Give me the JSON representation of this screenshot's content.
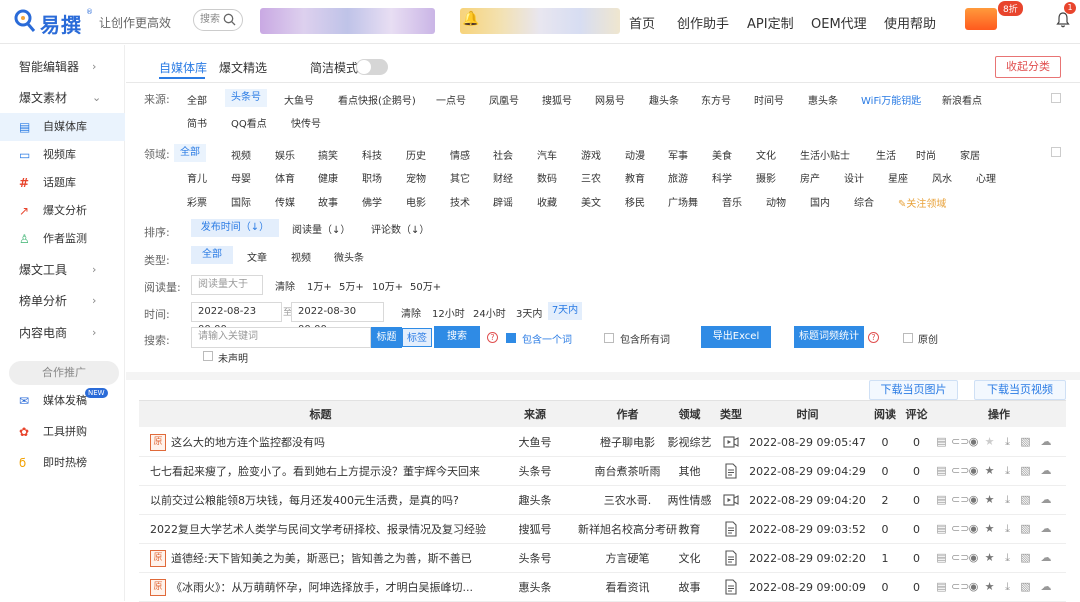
{
  "header": {
    "brand": "易撰",
    "slogan": "让创作更高效",
    "search_placeholder": "搜索",
    "nav": [
      "首页",
      "创作助手",
      "API定制",
      "OEM代理",
      "使用帮助"
    ],
    "promo_badge": "8折",
    "bell_count": "1"
  },
  "sidebar": {
    "items": [
      {
        "label": "智能编辑器",
        "chev": "›"
      },
      {
        "label": "爆文素材",
        "chev": "⌄"
      },
      {
        "label": "自媒体库"
      },
      {
        "label": "视频库"
      },
      {
        "label": "话题库"
      },
      {
        "label": "爆文分析"
      },
      {
        "label": "作者监测"
      },
      {
        "label": "爆文工具",
        "chev": "›"
      },
      {
        "label": "榜单分析",
        "chev": "›"
      },
      {
        "label": "内容电商",
        "chev": "›"
      }
    ],
    "promo_title": "合作推广",
    "promo_items": [
      "媒体发稿",
      "工具拼购",
      "即时热榜"
    ],
    "new_badge": "NEW"
  },
  "tabs": [
    "自媒体库",
    "爆文精选"
  ],
  "simple_mode_label": "简洁模式",
  "collapse_label": "收起分类",
  "filters": {
    "source_label": "来源:",
    "sources_row1": [
      "全部",
      "头条号",
      "大鱼号",
      "看点快报(企鹅号)",
      "一点号",
      "凤凰号",
      "搜狐号",
      "网易号",
      "趣头条",
      "东方号",
      "时间号",
      "惠头条",
      "WiFi万能钥匙",
      "新浪看点"
    ],
    "sources_row2": [
      "简书",
      "QQ看点",
      "快传号"
    ],
    "field_label": "领域:",
    "fields_row1": [
      "全部",
      "视频",
      "娱乐",
      "搞笑",
      "科技",
      "历史",
      "情感",
      "社会",
      "汽车",
      "游戏",
      "动漫",
      "军事",
      "美食",
      "文化",
      "生活小贴士",
      "生活",
      "时尚",
      "家居"
    ],
    "fields_row2": [
      "育儿",
      "母婴",
      "体育",
      "健康",
      "职场",
      "宠物",
      "其它",
      "财经",
      "数码",
      "三农",
      "教育",
      "旅游",
      "科学",
      "摄影",
      "房产",
      "设计",
      "星座",
      "风水",
      "心理"
    ],
    "fields_row3": [
      "彩票",
      "国际",
      "传媒",
      "故事",
      "佛学",
      "电影",
      "技术",
      "辟谣",
      "收藏",
      "美文",
      "移民",
      "广场舞",
      "音乐",
      "动物",
      "国内",
      "综合"
    ],
    "follow_field": "关注领域",
    "sort_label": "排序:",
    "sort_options": [
      "发布时间（↓）",
      "阅读量（↓）",
      "评论数（↓）"
    ],
    "type_label": "类型:",
    "type_options": [
      "全部",
      "文章",
      "视频",
      "微头条"
    ],
    "reads_label": "阅读量:",
    "reads_placeholder": "阅读量大于",
    "reads_options": [
      "清除",
      "1万+",
      "5万+",
      "10万+",
      "50万+"
    ],
    "time_label": "时间:",
    "time_start": "2022-08-23 00:00",
    "time_sep": "至",
    "time_end": "2022-08-30 00:00",
    "time_options": [
      "清除",
      "12小时",
      "24小时",
      "3天内",
      "7天内"
    ],
    "search_label": "搜索:",
    "keyword_placeholder": "请输入关键词",
    "scope_title": "标题",
    "scope_tag": "标签",
    "search_btn": "搜索",
    "include_one": "包含一个词",
    "include_all": "包含所有词",
    "export_btn": "导出Excel",
    "stats_btn": "标题词频统计",
    "original": "原创",
    "undeclared": "未声明"
  },
  "download": {
    "images": "下载当页图片",
    "videos": "下载当页视频"
  },
  "table": {
    "headers": [
      "标题",
      "来源",
      "作者",
      "领域",
      "类型",
      "时间",
      "阅读",
      "评论",
      "操作"
    ],
    "rows": [
      {
        "orig": true,
        "title": "这么大的地方连个监控都没有吗",
        "source": "大鱼号",
        "author": "橙子聊电影",
        "field": "影视综艺",
        "type": "video",
        "time": "2022-08-29 09:05:47",
        "reads": "0",
        "comments": "0"
      },
      {
        "orig": false,
        "title": "七七看起来瘦了，脸变小了。看到她右上方提示没？董宇辉今天回来",
        "source": "头条号",
        "author": "南台煮茶听雨",
        "field": "其他",
        "type": "doc",
        "time": "2022-08-29 09:04:29",
        "reads": "0",
        "comments": "0"
      },
      {
        "orig": false,
        "title": "以前交过公粮能领8万块钱，每月还发400元生活费，是真的吗?",
        "source": "趣头条",
        "author": "三农水哥.",
        "field": "两性情感",
        "type": "video",
        "time": "2022-08-29 09:04:20",
        "reads": "2",
        "comments": "0"
      },
      {
        "orig": false,
        "title": "2022复旦大学艺术人类学与民间文学考研择校、报录情况及复习经验",
        "source": "搜狐号",
        "author": "新祥旭名校高分考研",
        "field": "教育",
        "type": "doc",
        "time": "2022-08-29 09:03:52",
        "reads": "0",
        "comments": "0"
      },
      {
        "orig": true,
        "title": "道德经:天下皆知美之为美，斯恶已；皆知善之为善，斯不善已",
        "source": "头条号",
        "author": "方言硬笔",
        "field": "文化",
        "type": "doc",
        "time": "2022-08-29 09:02:20",
        "reads": "1",
        "comments": "0"
      },
      {
        "orig": true,
        "title": "《冰雨火》：从万萌萌怀孕，阿坤选择放手，才明白吴振峰切...",
        "source": "惠头条",
        "author": "看看资讯",
        "field": "故事",
        "type": "doc",
        "time": "2022-08-29 09:00:09",
        "reads": "0",
        "comments": "0"
      }
    ],
    "orig_mark": "原"
  }
}
